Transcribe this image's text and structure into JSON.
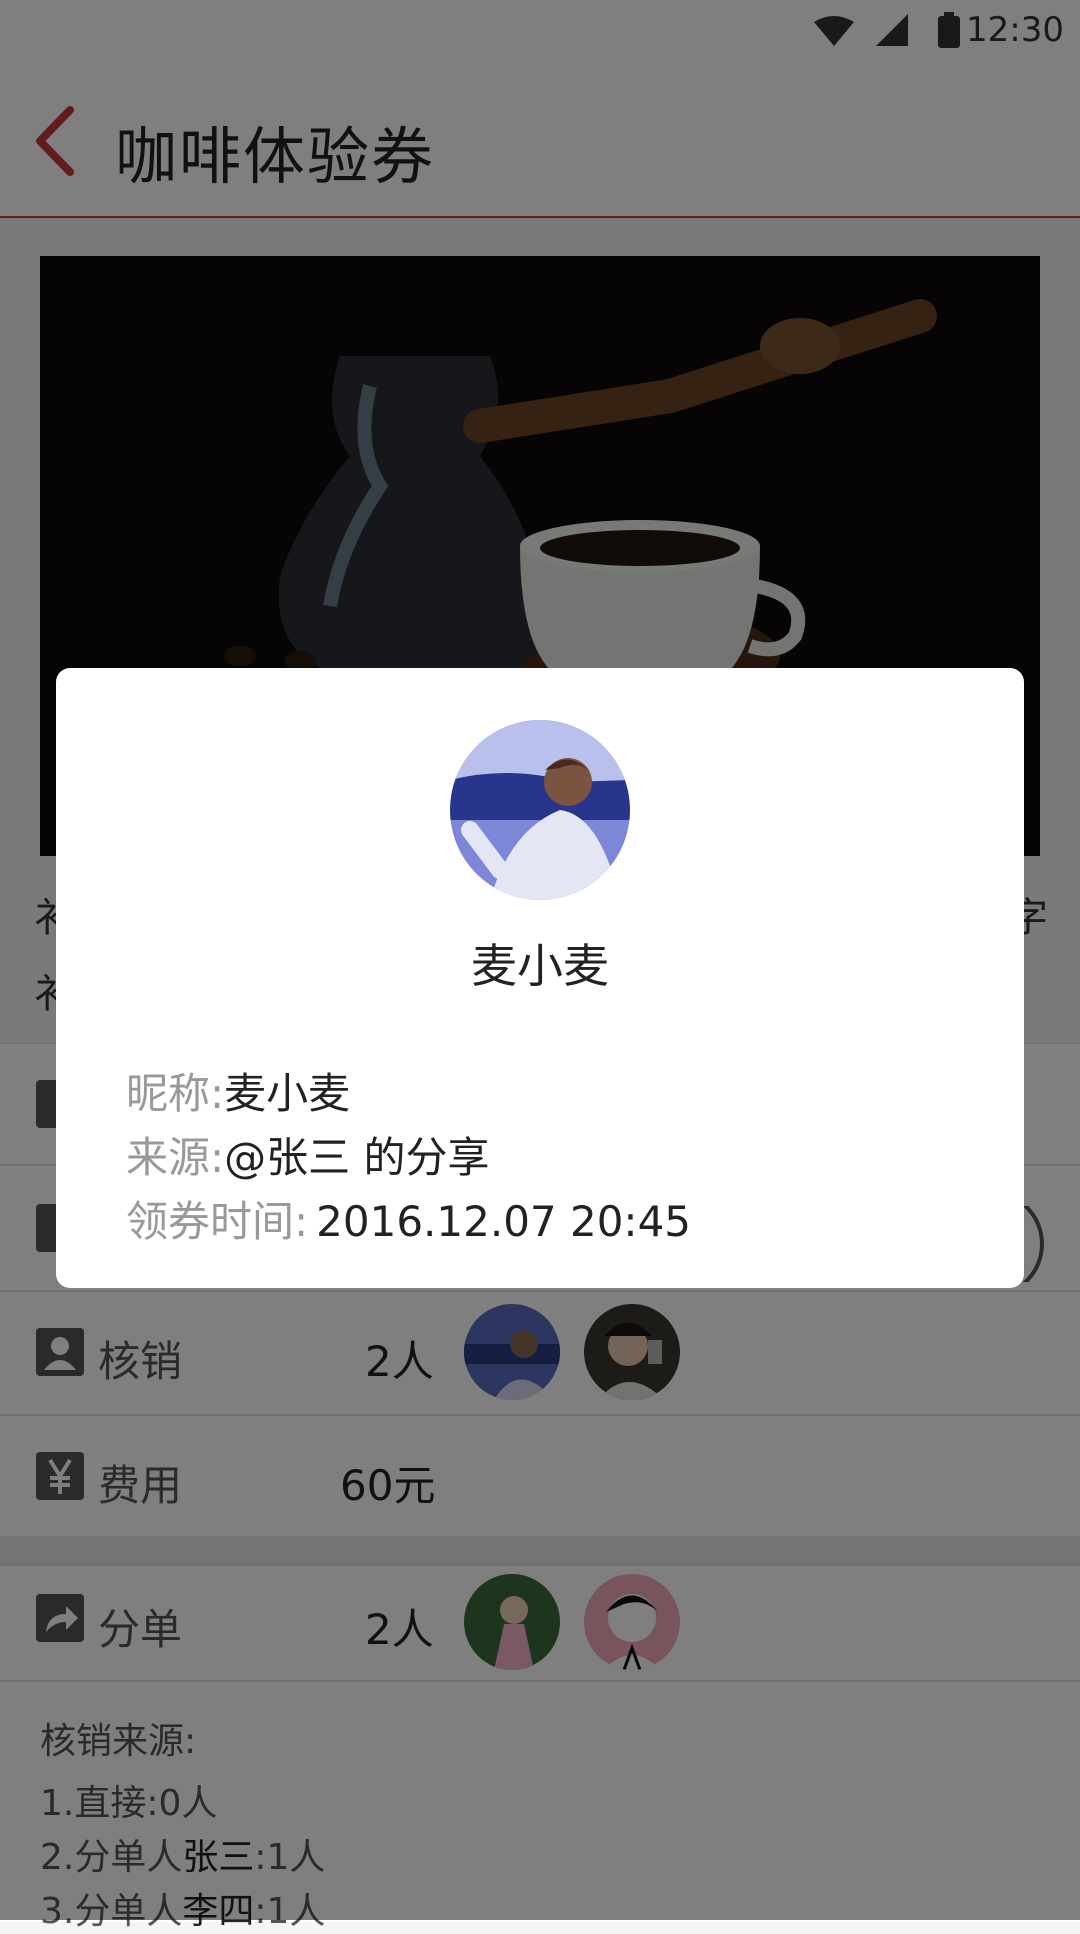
{
  "status_bar": {
    "time": "12:30",
    "icons": [
      "wifi-icon",
      "signal-icon",
      "battery-icon"
    ]
  },
  "header": {
    "title": "咖啡体验券",
    "back_icon": "chevron-left-icon",
    "accent_color": "#c9363b"
  },
  "hero": {
    "image": "coffee-pot-and-cup"
  },
  "description": {
    "left_line1": "衤",
    "left_line2": "衤",
    "right_line1": "字"
  },
  "rows": [
    {
      "id": "verify",
      "icon": "user-icon",
      "label": "核销",
      "value": "2人"
    },
    {
      "id": "cost",
      "icon": "yen-icon",
      "label": "费用",
      "value": "60元"
    },
    {
      "id": "share",
      "icon": "share-icon",
      "label": "分单",
      "value": "2人"
    }
  ],
  "origin": {
    "title": "核销来源:",
    "line1": "1.直接:0人",
    "line2_prefix": "2.分单人",
    "line2_name": "张三",
    "line2_suffix": ":1人",
    "line3_prefix": "3.分单人",
    "line3_name": "李四",
    "line3_suffix": ":1人"
  },
  "modal": {
    "name": "麦小麦",
    "nickname_label": "昵称:",
    "nickname_value": "麦小麦",
    "source_label": "来源:",
    "source_value": "@张三 的分享",
    "time_label": "领券时间:",
    "time_value": "2016.12.07 20:45"
  }
}
